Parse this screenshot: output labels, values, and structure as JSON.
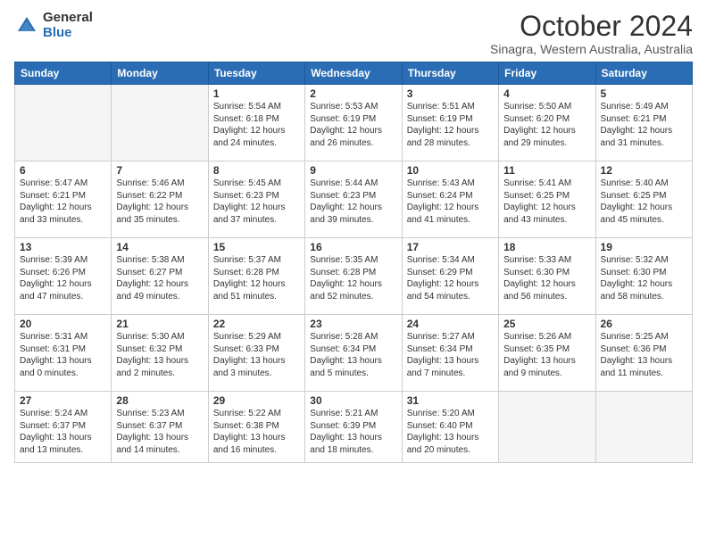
{
  "logo": {
    "general": "General",
    "blue": "Blue"
  },
  "header": {
    "title": "October 2024",
    "subtitle": "Sinagra, Western Australia, Australia"
  },
  "days_of_week": [
    "Sunday",
    "Monday",
    "Tuesday",
    "Wednesday",
    "Thursday",
    "Friday",
    "Saturday"
  ],
  "weeks": [
    [
      {
        "day": "",
        "info": ""
      },
      {
        "day": "",
        "info": ""
      },
      {
        "day": "1",
        "info": "Sunrise: 5:54 AM\nSunset: 6:18 PM\nDaylight: 12 hours and 24 minutes."
      },
      {
        "day": "2",
        "info": "Sunrise: 5:53 AM\nSunset: 6:19 PM\nDaylight: 12 hours and 26 minutes."
      },
      {
        "day": "3",
        "info": "Sunrise: 5:51 AM\nSunset: 6:19 PM\nDaylight: 12 hours and 28 minutes."
      },
      {
        "day": "4",
        "info": "Sunrise: 5:50 AM\nSunset: 6:20 PM\nDaylight: 12 hours and 29 minutes."
      },
      {
        "day": "5",
        "info": "Sunrise: 5:49 AM\nSunset: 6:21 PM\nDaylight: 12 hours and 31 minutes."
      }
    ],
    [
      {
        "day": "6",
        "info": "Sunrise: 5:47 AM\nSunset: 6:21 PM\nDaylight: 12 hours and 33 minutes."
      },
      {
        "day": "7",
        "info": "Sunrise: 5:46 AM\nSunset: 6:22 PM\nDaylight: 12 hours and 35 minutes."
      },
      {
        "day": "8",
        "info": "Sunrise: 5:45 AM\nSunset: 6:23 PM\nDaylight: 12 hours and 37 minutes."
      },
      {
        "day": "9",
        "info": "Sunrise: 5:44 AM\nSunset: 6:23 PM\nDaylight: 12 hours and 39 minutes."
      },
      {
        "day": "10",
        "info": "Sunrise: 5:43 AM\nSunset: 6:24 PM\nDaylight: 12 hours and 41 minutes."
      },
      {
        "day": "11",
        "info": "Sunrise: 5:41 AM\nSunset: 6:25 PM\nDaylight: 12 hours and 43 minutes."
      },
      {
        "day": "12",
        "info": "Sunrise: 5:40 AM\nSunset: 6:25 PM\nDaylight: 12 hours and 45 minutes."
      }
    ],
    [
      {
        "day": "13",
        "info": "Sunrise: 5:39 AM\nSunset: 6:26 PM\nDaylight: 12 hours and 47 minutes."
      },
      {
        "day": "14",
        "info": "Sunrise: 5:38 AM\nSunset: 6:27 PM\nDaylight: 12 hours and 49 minutes."
      },
      {
        "day": "15",
        "info": "Sunrise: 5:37 AM\nSunset: 6:28 PM\nDaylight: 12 hours and 51 minutes."
      },
      {
        "day": "16",
        "info": "Sunrise: 5:35 AM\nSunset: 6:28 PM\nDaylight: 12 hours and 52 minutes."
      },
      {
        "day": "17",
        "info": "Sunrise: 5:34 AM\nSunset: 6:29 PM\nDaylight: 12 hours and 54 minutes."
      },
      {
        "day": "18",
        "info": "Sunrise: 5:33 AM\nSunset: 6:30 PM\nDaylight: 12 hours and 56 minutes."
      },
      {
        "day": "19",
        "info": "Sunrise: 5:32 AM\nSunset: 6:30 PM\nDaylight: 12 hours and 58 minutes."
      }
    ],
    [
      {
        "day": "20",
        "info": "Sunrise: 5:31 AM\nSunset: 6:31 PM\nDaylight: 13 hours and 0 minutes."
      },
      {
        "day": "21",
        "info": "Sunrise: 5:30 AM\nSunset: 6:32 PM\nDaylight: 13 hours and 2 minutes."
      },
      {
        "day": "22",
        "info": "Sunrise: 5:29 AM\nSunset: 6:33 PM\nDaylight: 13 hours and 3 minutes."
      },
      {
        "day": "23",
        "info": "Sunrise: 5:28 AM\nSunset: 6:34 PM\nDaylight: 13 hours and 5 minutes."
      },
      {
        "day": "24",
        "info": "Sunrise: 5:27 AM\nSunset: 6:34 PM\nDaylight: 13 hours and 7 minutes."
      },
      {
        "day": "25",
        "info": "Sunrise: 5:26 AM\nSunset: 6:35 PM\nDaylight: 13 hours and 9 minutes."
      },
      {
        "day": "26",
        "info": "Sunrise: 5:25 AM\nSunset: 6:36 PM\nDaylight: 13 hours and 11 minutes."
      }
    ],
    [
      {
        "day": "27",
        "info": "Sunrise: 5:24 AM\nSunset: 6:37 PM\nDaylight: 13 hours and 13 minutes."
      },
      {
        "day": "28",
        "info": "Sunrise: 5:23 AM\nSunset: 6:37 PM\nDaylight: 13 hours and 14 minutes."
      },
      {
        "day": "29",
        "info": "Sunrise: 5:22 AM\nSunset: 6:38 PM\nDaylight: 13 hours and 16 minutes."
      },
      {
        "day": "30",
        "info": "Sunrise: 5:21 AM\nSunset: 6:39 PM\nDaylight: 13 hours and 18 minutes."
      },
      {
        "day": "31",
        "info": "Sunrise: 5:20 AM\nSunset: 6:40 PM\nDaylight: 13 hours and 20 minutes."
      },
      {
        "day": "",
        "info": ""
      },
      {
        "day": "",
        "info": ""
      }
    ]
  ]
}
